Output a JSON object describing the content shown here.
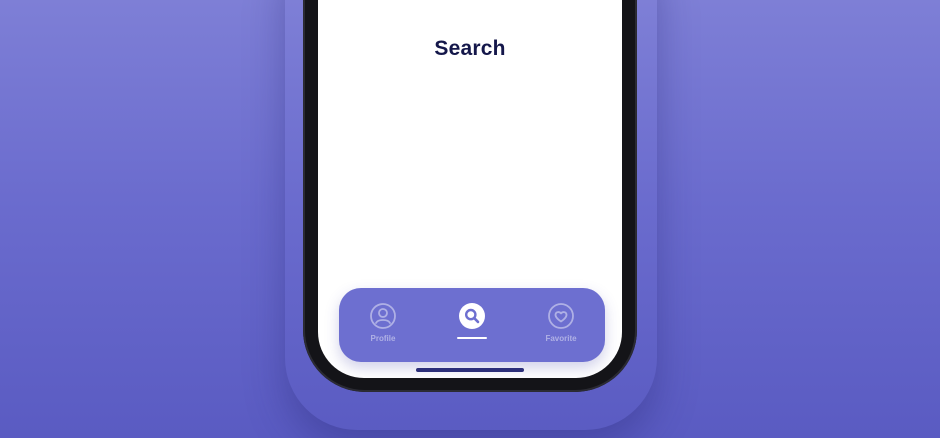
{
  "screen": {
    "title": "Search"
  },
  "tab_bar": {
    "active_tab": "search",
    "items": [
      {
        "id": "profile",
        "label": "Profile",
        "icon": "profile-icon"
      },
      {
        "id": "search",
        "label": "",
        "icon": "search-icon"
      },
      {
        "id": "favorite",
        "label": "Favorite",
        "icon": "heart-icon"
      }
    ]
  },
  "colors": {
    "background": "#7677d3",
    "tab_bar": "#6d6fd0",
    "title_text": "#14174a",
    "screen": "#ffffff"
  }
}
